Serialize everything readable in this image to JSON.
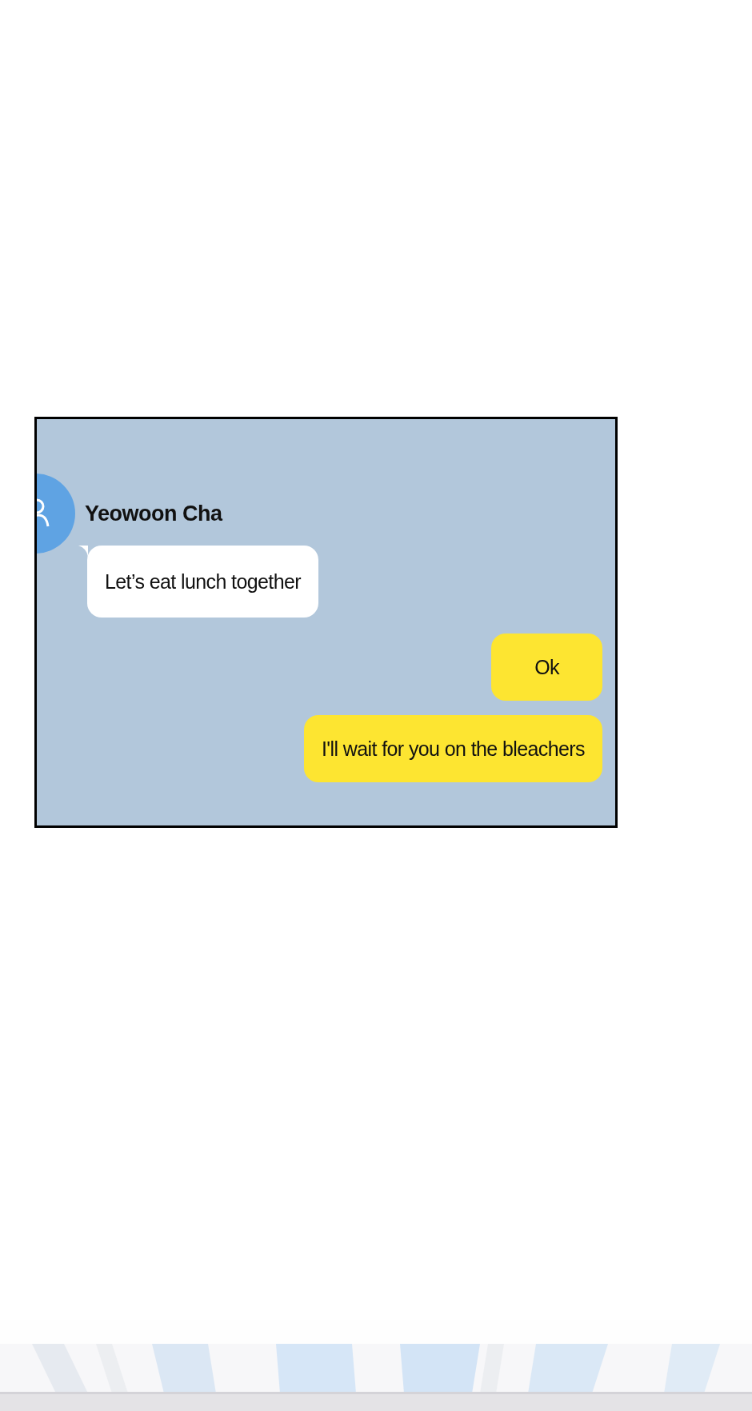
{
  "chat": {
    "contact": {
      "name": "Yeowoon Cha"
    },
    "messages": [
      {
        "text": "Let’s eat lunch together",
        "kind": "incoming"
      },
      {
        "text": "Ok",
        "kind": "outgoing"
      },
      {
        "text": "I'll wait for you on the bleachers",
        "kind": "outgoing"
      }
    ]
  }
}
